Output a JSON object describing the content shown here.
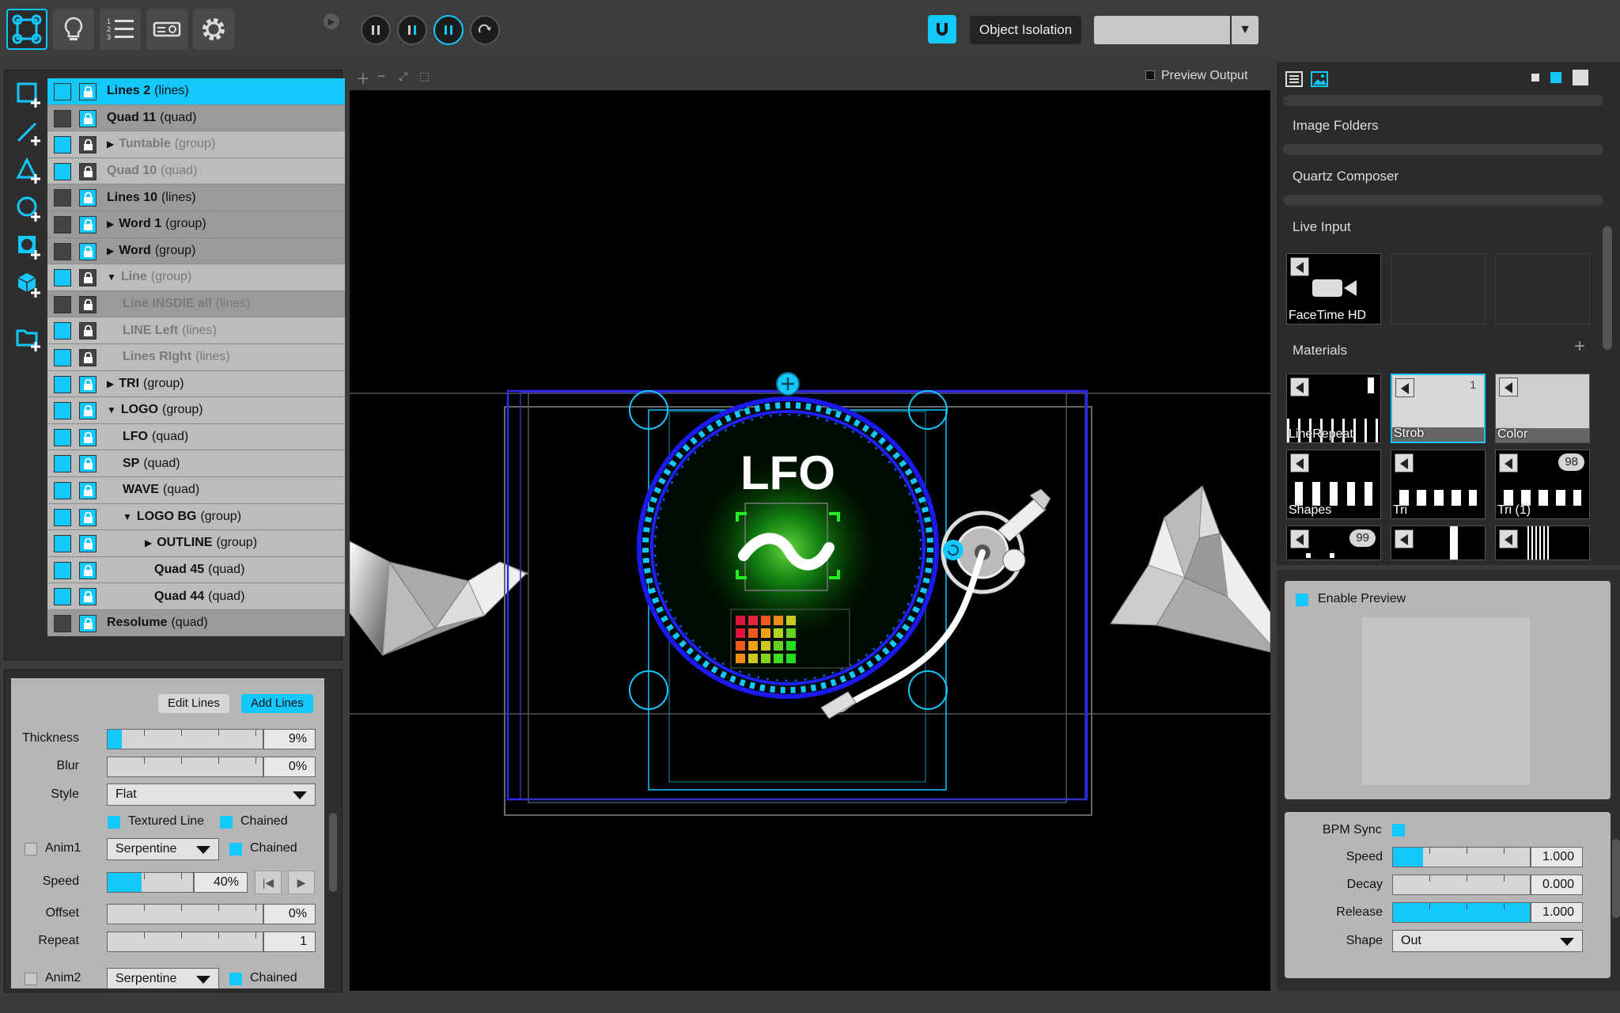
{
  "colors": {
    "accent": "#14c8ff",
    "panel": "#2e2e2e",
    "canvas": "#000000"
  },
  "topbar": {
    "modes": [
      "mapping-mode-icon",
      "lightbulb-icon",
      "numbered-list-icon",
      "projector-icon",
      "gear-icon"
    ],
    "transport": [
      "pause-icon",
      "pause-icon",
      "pause-icon",
      "redo-icon"
    ],
    "object_isolation_label": "Object Isolation",
    "isolation_combo_value": ""
  },
  "tools": [
    "add-quad-icon",
    "add-line-icon",
    "add-triangle-icon",
    "add-circle-icon",
    "add-mask-icon",
    "add-3d-object-icon",
    "add-folder-icon"
  ],
  "layers": [
    {
      "name": "Lines 2",
      "type": "(lines)",
      "indent": 0,
      "arrow": "",
      "visible": true,
      "locked": false,
      "state": "selected"
    },
    {
      "name": "Quad 11",
      "type": "(quad)",
      "indent": 0,
      "arrow": "",
      "visible": false,
      "locked": false,
      "state": "dim"
    },
    {
      "name": "Tuntable",
      "type": "(group)",
      "indent": 0,
      "arrow": "right",
      "visible": true,
      "locked": true,
      "state": "grey"
    },
    {
      "name": "Quad 10",
      "type": "(quad)",
      "indent": 0,
      "arrow": "",
      "visible": true,
      "locked": true,
      "state": "grey"
    },
    {
      "name": "Lines 10",
      "type": "(lines)",
      "indent": 0,
      "arrow": "",
      "visible": false,
      "locked": false,
      "state": "dim"
    },
    {
      "name": "Word 1",
      "type": "(group)",
      "indent": 0,
      "arrow": "right",
      "visible": false,
      "locked": false,
      "state": "dim"
    },
    {
      "name": "Word",
      "type": "(group)",
      "indent": 0,
      "arrow": "right",
      "visible": false,
      "locked": false,
      "state": "dim"
    },
    {
      "name": "Line",
      "type": "(group)",
      "indent": 0,
      "arrow": "down",
      "visible": true,
      "locked": true,
      "state": "grey"
    },
    {
      "name": "Line INSDIE all",
      "type": "(lines)",
      "indent": 1,
      "arrow": "",
      "visible": false,
      "locked": true,
      "state": "greydim"
    },
    {
      "name": "LINE Left",
      "type": "(lines)",
      "indent": 1,
      "arrow": "",
      "visible": true,
      "locked": true,
      "state": "grey"
    },
    {
      "name": "Lines RIght",
      "type": "(lines)",
      "indent": 1,
      "arrow": "",
      "visible": true,
      "locked": true,
      "state": "grey"
    },
    {
      "name": "TRI",
      "type": "(group)",
      "indent": 0,
      "arrow": "right",
      "visible": true,
      "locked": false,
      "state": "normal"
    },
    {
      "name": "LOGO",
      "type": "(group)",
      "indent": 0,
      "arrow": "down",
      "visible": true,
      "locked": false,
      "state": "normal"
    },
    {
      "name": "LFO",
      "type": "(quad)",
      "indent": 1,
      "arrow": "",
      "visible": true,
      "locked": false,
      "state": "normal"
    },
    {
      "name": "SP",
      "type": "(quad)",
      "indent": 1,
      "arrow": "",
      "visible": true,
      "locked": false,
      "state": "normal"
    },
    {
      "name": "WAVE",
      "type": "(quad)",
      "indent": 1,
      "arrow": "",
      "visible": true,
      "locked": false,
      "state": "normal"
    },
    {
      "name": "LOGO BG",
      "type": "(group)",
      "indent": 1,
      "arrow": "down",
      "visible": true,
      "locked": false,
      "state": "normal"
    },
    {
      "name": "OUTLINE",
      "type": "(group)",
      "indent": 2,
      "arrow": "right",
      "visible": true,
      "locked": false,
      "state": "normal"
    },
    {
      "name": "Quad 45",
      "type": "(quad)",
      "indent": 2,
      "arrow": "",
      "visible": true,
      "locked": false,
      "state": "normal"
    },
    {
      "name": "Quad 44",
      "type": "(quad)",
      "indent": 2,
      "arrow": "",
      "visible": true,
      "locked": false,
      "state": "normal"
    },
    {
      "name": "Resolume",
      "type": "(quad)",
      "indent": 0,
      "arrow": "",
      "visible": false,
      "locked": false,
      "state": "dim"
    }
  ],
  "props": {
    "edit_lines": "Edit Lines",
    "add_lines": "Add Lines",
    "thickness": {
      "label": "Thickness",
      "value": "9%",
      "level": 0.09
    },
    "blur": {
      "label": "Blur",
      "value": "0%",
      "level": 0
    },
    "style": {
      "label": "Style",
      "value": "Flat"
    },
    "textured_line": "Textured Line",
    "chained": "Chained",
    "anim1": {
      "label": "Anim1",
      "value": "Serpentine",
      "chained": "Chained"
    },
    "speed": {
      "label": "Speed",
      "value": "40%",
      "level": 0.4
    },
    "offset": {
      "label": "Offset",
      "value": "0%",
      "level": 0
    },
    "repeat": {
      "label": "Repeat",
      "value": "1",
      "level": 0
    },
    "anim2": {
      "label": "Anim2",
      "value": "Serpentine",
      "chained": "Chained"
    }
  },
  "canvas": {
    "toolbar_icons": [
      "zoom-in-icon",
      "zoom-out-icon",
      "fit-icon",
      "fullscreen-icon"
    ],
    "preview_output": "Preview Output",
    "logo_text": "LFO"
  },
  "sources": {
    "tabs": [
      "list-view-icon",
      "image-view-icon"
    ],
    "image_folders": "Image Folders",
    "quartz_composer": "Quartz Composer",
    "live_input": "Live Input",
    "facetime": "FaceTime HD",
    "materials": "Materials",
    "materials_list": [
      {
        "label": "LineRepeat",
        "badge": ""
      },
      {
        "label": "Strob",
        "badge": "",
        "count": "1"
      },
      {
        "label": "Color",
        "badge": ""
      },
      {
        "label": "Shapes",
        "badge": ""
      },
      {
        "label": "Tri",
        "badge": ""
      },
      {
        "label": "Tri (1)",
        "badge": "98"
      },
      {
        "label": "",
        "badge": "99"
      },
      {
        "label": "",
        "badge": ""
      },
      {
        "label": "",
        "badge": ""
      }
    ]
  },
  "preview": {
    "enable_label": "Enable Preview"
  },
  "bpm": {
    "sync_label": "BPM Sync",
    "speed": {
      "label": "Speed",
      "value": "1.000",
      "level": 0.22
    },
    "decay": {
      "label": "Decay",
      "value": "0.000",
      "level": 0
    },
    "release": {
      "label": "Release",
      "value": "1.000",
      "level": 1
    },
    "shape": {
      "label": "Shape",
      "value": "Out"
    }
  }
}
